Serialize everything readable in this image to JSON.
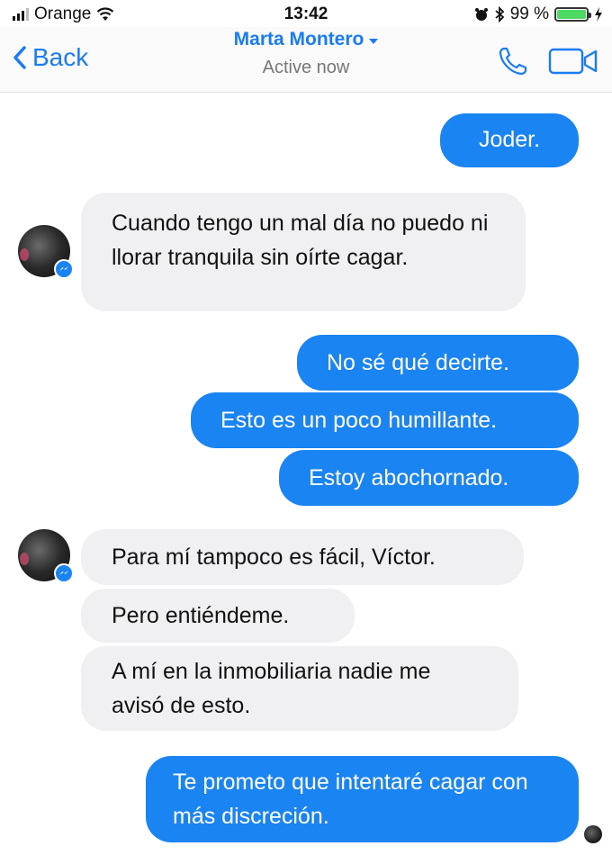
{
  "status_bar": {
    "carrier": "Orange",
    "time": "13:42",
    "battery_percent": "99 %",
    "battery_level": 0.99
  },
  "nav": {
    "back_label": "Back",
    "contact_name": "Marta Montero",
    "presence": "Active now"
  },
  "messages": [
    {
      "from": "me",
      "text": "Joder."
    },
    {
      "from": "them",
      "text": "Cuando tengo un mal día no puedo ni llorar tranquila sin oírte cagar."
    },
    {
      "from": "me",
      "text": "No sé qué decirte."
    },
    {
      "from": "me",
      "text": "Esto es un poco humillante."
    },
    {
      "from": "me",
      "text": "Estoy abochornado."
    },
    {
      "from": "them",
      "text": "Para mí tampoco es fácil, Víctor."
    },
    {
      "from": "them",
      "text": "Pero entiéndeme."
    },
    {
      "from": "them",
      "text": "A mí en la inmobiliaria nadie me avisó de esto."
    },
    {
      "from": "me",
      "text": "Te prometo que intentaré cagar con más discreción."
    }
  ],
  "colors": {
    "accent": "#1a7cf5",
    "outgoing_bubble": "#1a84f3",
    "incoming_bubble": "#f0f0f2",
    "battery": "#4cd964"
  },
  "icons": [
    "signal-icon",
    "wifi-icon",
    "alarm-icon",
    "bluetooth-icon",
    "battery-icon",
    "charging-icon",
    "back-chevron-icon",
    "phone-icon",
    "video-camera-icon",
    "messenger-badge-icon"
  ]
}
